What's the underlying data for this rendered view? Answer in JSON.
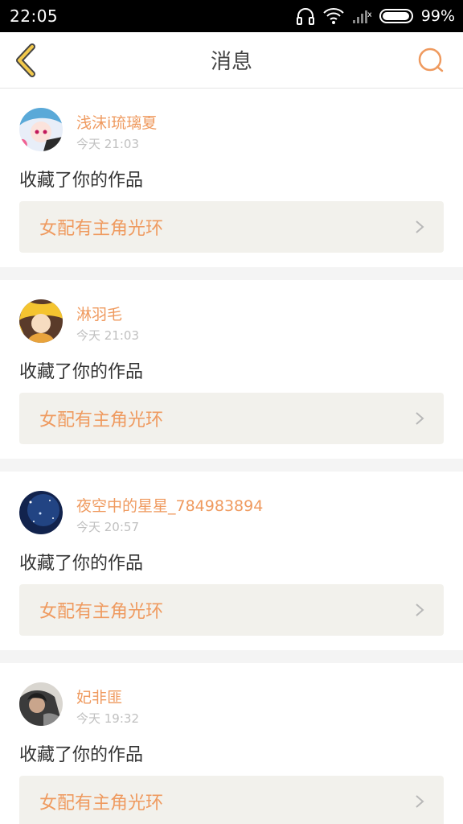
{
  "statusbar": {
    "time": "22:05",
    "battery": "99%",
    "battery_level": 0.99
  },
  "navbar": {
    "title": "消息",
    "back_icon": "chevron-left-icon",
    "search_icon": "search-icon"
  },
  "colors": {
    "accent": "#ef9a5f",
    "back_arrow": "#f2c94c",
    "card_bg": "#ffffff",
    "work_bg": "#f2f1ec"
  },
  "messages": [
    {
      "username": "浅沫i琉璃夏",
      "time": "今天 21:03",
      "action": "收藏了你的作品",
      "work_title": "女配有主角光环"
    },
    {
      "username": "淋羽毛",
      "time": "今天 21:03",
      "action": "收藏了你的作品",
      "work_title": "女配有主角光环"
    },
    {
      "username": "夜空中的星星_784983894",
      "time": "今天 20:57",
      "action": "收藏了你的作品",
      "work_title": "女配有主角光环"
    },
    {
      "username": "妃非匪",
      "time": "今天 19:32",
      "action": "收藏了你的作品",
      "work_title": "女配有主角光环"
    }
  ]
}
